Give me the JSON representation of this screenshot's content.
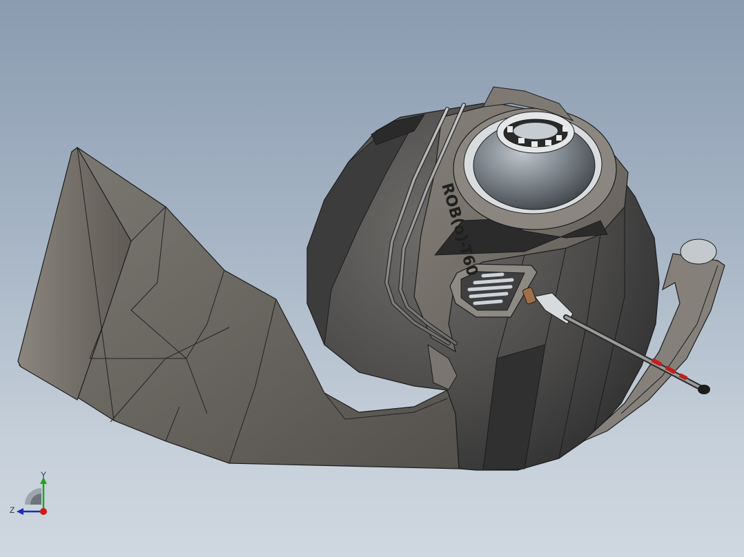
{
  "graphics_area": {
    "model_label": "ROB(o)-T60",
    "colors": {
      "background_top": "#8a9bb0",
      "background_bottom": "#cfd7e0",
      "body_gray": "#6f6c67",
      "dark_panel": "#3a3a3c",
      "edge": "#1c1c1c"
    }
  },
  "triad": {
    "y_label": "Y",
    "z_label": "Z",
    "colors": {
      "y_axis": "#1fa51f",
      "z_axis": "#1a2db8",
      "x_axis": "#d01818"
    }
  }
}
